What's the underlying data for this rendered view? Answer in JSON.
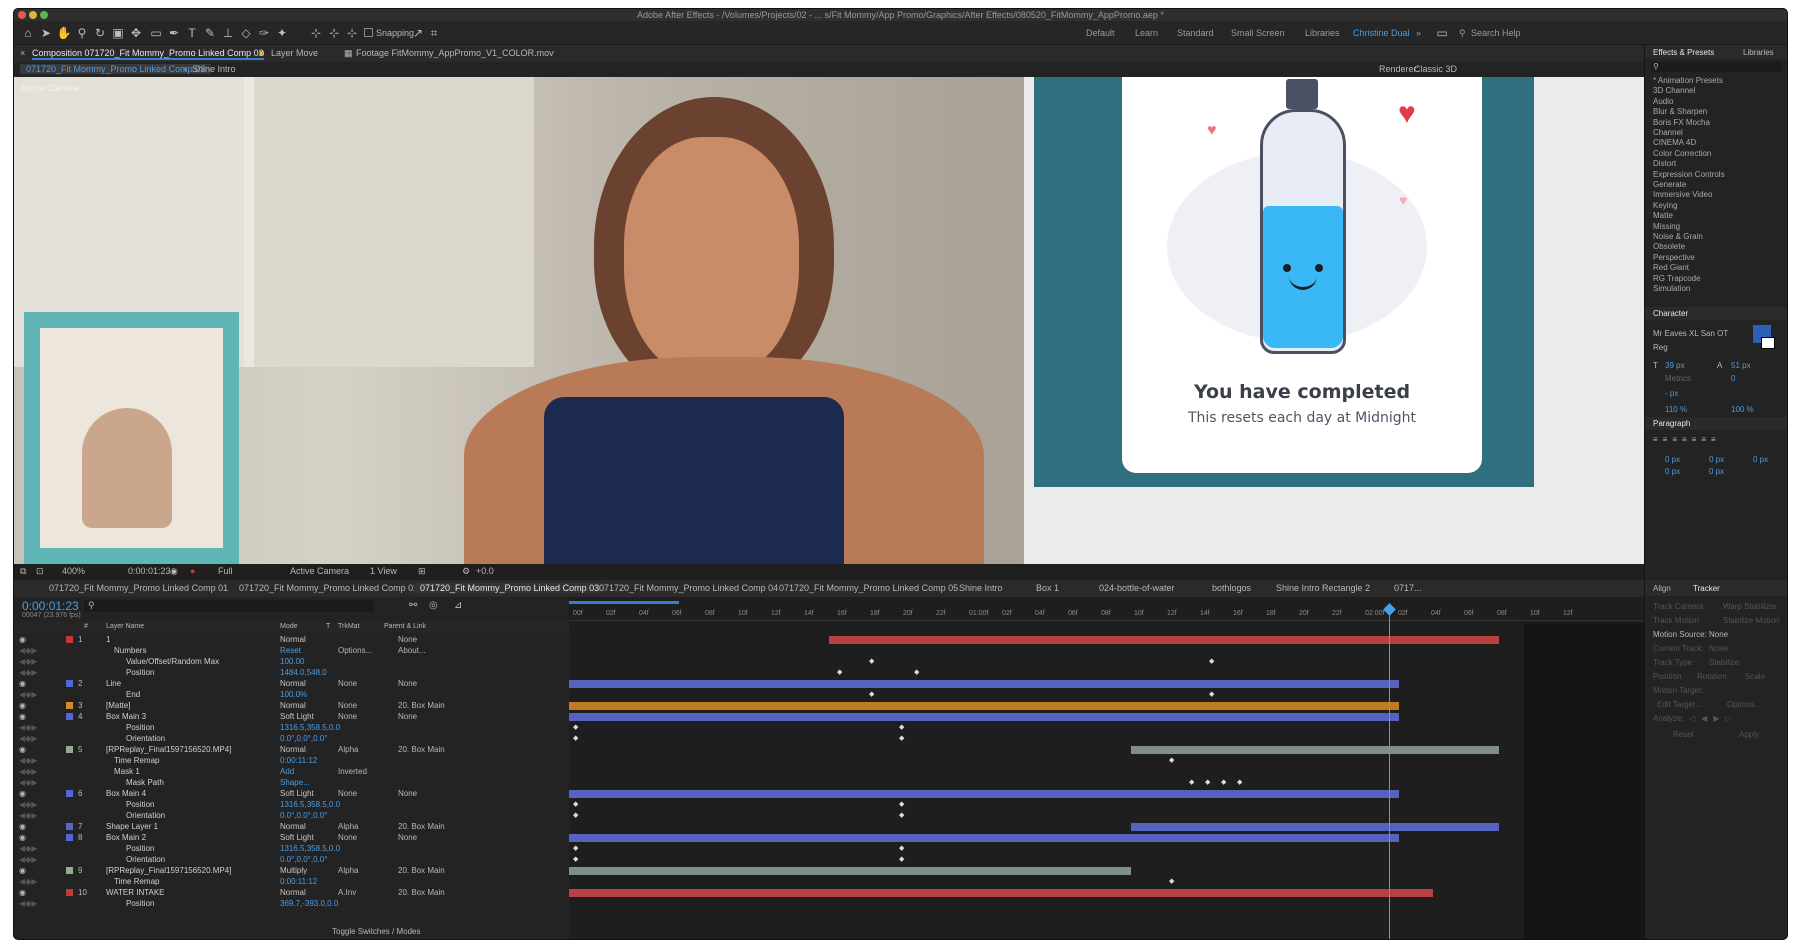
{
  "window": {
    "title": "Adobe After Effects - /Volumes/Projects/02 - ... s/Fit Mommy/App Promo/Graphics/After Effects/080520_FitMommy_AppPromo.aep *"
  },
  "toolbar": {
    "snapping": "Snapping",
    "workspaces": [
      "Default",
      "Learn",
      "Standard",
      "Small Screen",
      "Libraries",
      "Christine Dual"
    ],
    "search_placeholder": "Search Help"
  },
  "viewer_tabs": {
    "comp_label": "Composition 071720_Fit Mommy_Promo Linked Comp 03",
    "layer": "Layer Move",
    "footage": "Footage FitMommy_AppPromo_V1_COLOR.mov",
    "crumb1": "071720_Fit Mommy_Promo Linked Comp 03",
    "crumb2": "Shine Intro",
    "renderer": "Renderer:",
    "renderer_value": "Classic 3D",
    "active_camera": "Active Camera"
  },
  "phone": {
    "headline": "You have completed",
    "sub": "This resets each day at Midnight"
  },
  "viewer_bottom": {
    "zoom": "400%",
    "timecode": "0:00:01:23",
    "resolution": "Full",
    "camera": "Active Camera",
    "view": "1 View",
    "offset": "+0.0"
  },
  "comp_tabs": [
    "071720_Fit Mommy_Promo Linked Comp 01",
    "071720_Fit Mommy_Promo Linked Comp 02",
    "071720_Fit Mommy_Promo Linked Comp 03",
    "071720_Fit Mommy_Promo Linked Comp 04",
    "071720_Fit Mommy_Promo Linked Comp 05",
    "Shine Intro",
    "Box 1",
    "024-bottle-of-water",
    "bothlogos",
    "Shine Intro Rectangle 2",
    "0717..."
  ],
  "timeline": {
    "timecode": "0:00:01:23",
    "fps": "00047 (23.976 fps)",
    "col_num": "#",
    "col_layer": "Layer Name",
    "col_mode": "Mode",
    "col_t": "T",
    "col_trkmat": "TrkMat",
    "col_parent": "Parent & Link",
    "footer": "Toggle Switches / Modes",
    "ruler": [
      "00f",
      "02f",
      "04f",
      "06f",
      "08f",
      "10f",
      "12f",
      "14f",
      "16f",
      "18f",
      "20f",
      "22f",
      "01:00f",
      "02f",
      "04f",
      "06f",
      "08f",
      "10f",
      "12f",
      "14f",
      "16f",
      "18f",
      "20f",
      "22f",
      "02:00f",
      "02f",
      "04f",
      "06f",
      "08f",
      "10f",
      "12f"
    ],
    "rows": [
      {
        "num": "1",
        "name": "1",
        "mode": "Normal",
        "trk": "",
        "parent": "None",
        "color": "#c23b3b",
        "lvl": 0
      },
      {
        "num": "",
        "name": "Numbers",
        "mode": "Reset",
        "trk": "Options...",
        "parent": "About...",
        "color": "",
        "lvl": 1
      },
      {
        "num": "",
        "name": "Value/Offset/Random Max",
        "mode": "100.00",
        "trk": "",
        "parent": "",
        "color": "",
        "lvl": 2
      },
      {
        "num": "",
        "name": "Position",
        "mode": "1484.0,548.0",
        "trk": "",
        "parent": "",
        "color": "",
        "lvl": 2
      },
      {
        "num": "2",
        "name": "Line",
        "mode": "Normal",
        "trk": "None",
        "parent": "None",
        "color": "#5566cc",
        "lvl": 0
      },
      {
        "num": "",
        "name": "End",
        "mode": "100.0%",
        "trk": "",
        "parent": "",
        "color": "",
        "lvl": 2
      },
      {
        "num": "3",
        "name": "[Matte]",
        "mode": "Normal",
        "trk": "None",
        "parent": "20. Box Main",
        "color": "#d38a2a",
        "lvl": 0
      },
      {
        "num": "4",
        "name": "Box Main 3",
        "mode": "Soft Light",
        "trk": "None",
        "parent": "None",
        "color": "#5566cc",
        "lvl": 0
      },
      {
        "num": "",
        "name": "Position",
        "mode": "1316.5,358.5,0.0",
        "trk": "",
        "parent": "",
        "color": "",
        "lvl": 2
      },
      {
        "num": "",
        "name": "Orientation",
        "mode": "0.0°,0.0°,0.0°",
        "trk": "",
        "parent": "",
        "color": "",
        "lvl": 2
      },
      {
        "num": "5",
        "name": "[RPReplay_Final1597156520.MP4]",
        "mode": "Normal",
        "trk": "Alpha",
        "parent": "20. Box Main",
        "color": "#8fae8f",
        "lvl": 0
      },
      {
        "num": "",
        "name": "Time Remap",
        "mode": "0:00:11:12",
        "trk": "",
        "parent": "",
        "color": "",
        "lvl": 1
      },
      {
        "num": "",
        "name": "Mask 1",
        "mode": "Add",
        "trk": "Inverted",
        "parent": "",
        "color": "",
        "lvl": 1
      },
      {
        "num": "",
        "name": "Mask Path",
        "mode": "Shape...",
        "trk": "",
        "parent": "",
        "color": "",
        "lvl": 2
      },
      {
        "num": "6",
        "name": "Box Main 4",
        "mode": "Soft Light",
        "trk": "None",
        "parent": "None",
        "color": "#5566cc",
        "lvl": 0
      },
      {
        "num": "",
        "name": "Position",
        "mode": "1316.5,358.5,0.0",
        "trk": "",
        "parent": "",
        "color": "",
        "lvl": 2
      },
      {
        "num": "",
        "name": "Orientation",
        "mode": "0.0°,0.0°,0.0°",
        "trk": "",
        "parent": "",
        "color": "",
        "lvl": 2
      },
      {
        "num": "7",
        "name": "Shape Layer 1",
        "mode": "Normal",
        "trk": "Alpha",
        "parent": "20. Box Main",
        "color": "#5566cc",
        "lvl": 0
      },
      {
        "num": "8",
        "name": "Box Main 2",
        "mode": "Soft Light",
        "trk": "None",
        "parent": "None",
        "color": "#5566cc",
        "lvl": 0
      },
      {
        "num": "",
        "name": "Position",
        "mode": "1316.5,358.5,0.0",
        "trk": "",
        "parent": "",
        "color": "",
        "lvl": 2
      },
      {
        "num": "",
        "name": "Orientation",
        "mode": "0.0°,0.0°,0.0°",
        "trk": "",
        "parent": "",
        "color": "",
        "lvl": 2
      },
      {
        "num": "9",
        "name": "[RPReplay_Final1597156520.MP4]",
        "mode": "Multiply",
        "trk": "Alpha",
        "parent": "20. Box Main",
        "color": "#8fae8f",
        "lvl": 0
      },
      {
        "num": "",
        "name": "Time Remap",
        "mode": "0:00:11:12",
        "trk": "",
        "parent": "",
        "color": "",
        "lvl": 1
      },
      {
        "num": "10",
        "name": "WATER INTAKE",
        "mode": "Normal",
        "trk": "A.Inv",
        "parent": "20. Box Main",
        "color": "#c23b3b",
        "lvl": 0
      },
      {
        "num": "",
        "name": "Position",
        "mode": "369.7,-393.0,0.0",
        "trk": "",
        "parent": "",
        "color": "",
        "lvl": 2
      }
    ]
  },
  "effects": {
    "title": "Effects & Presets",
    "tab2": "Libraries",
    "items": [
      "* Animation Presets",
      "3D Channel",
      "Audio",
      "Blur & Sharpen",
      "Boris FX Mocha",
      "Channel",
      "CINEMA 4D",
      "Color Correction",
      "Distort",
      "Expression Controls",
      "Generate",
      "Immersive Video",
      "Keying",
      "Matte",
      "Missing",
      "Noise & Grain",
      "Obsolete",
      "Perspective",
      "Red Giant",
      "RG Trapcode",
      "Simulation"
    ]
  },
  "character": {
    "title": "Character",
    "font": "Mr Eaves XL San OT",
    "style": "Reg",
    "size": "39 px",
    "leading": "51 px",
    "kerning": "Metrics",
    "tracking": "0",
    "stroke": "- px",
    "vscale": "110 %",
    "hscale": "100 %"
  },
  "paragraph": {
    "title": "Paragraph",
    "v": "0 px"
  },
  "tracker": {
    "align": "Align",
    "title": "Tracker",
    "track_camera": "Track Camera",
    "warp": "Warp Stabilizer",
    "track_motion": "Track Motion",
    "stabilize": "Stabilize Motion",
    "motion_source": "Motion Source:",
    "motion_source_v": "None",
    "current_track": "Current Track:",
    "current_track_v": "None",
    "track_type": "Track Type:",
    "track_type_v": "Stabilize",
    "position": "Position",
    "rotation": "Rotation",
    "scale": "Scale",
    "motion_target": "Motion Target:",
    "edit_target": "Edit Target...",
    "options": "Options...",
    "analyze": "Analyze:",
    "reset": "Reset",
    "apply": "Apply"
  }
}
